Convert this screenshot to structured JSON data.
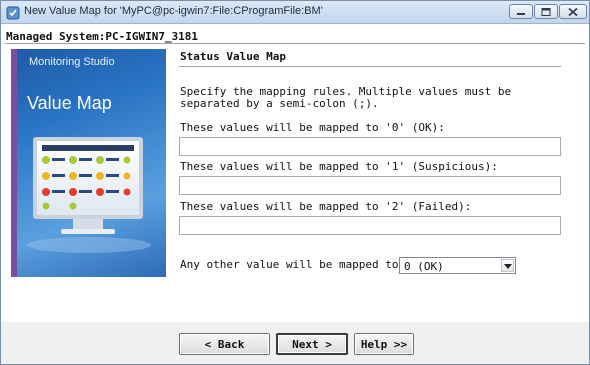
{
  "window": {
    "title": "New Value Map for 'MyPC@pc-igwin7:File:CProgramFile:BM'"
  },
  "system": {
    "label": "Managed System:PC-IGWIN7_3181"
  },
  "banner": {
    "brand": "Monitoring Studio",
    "title": "Value Map"
  },
  "content": {
    "heading": "Status Value Map",
    "instructions": "Specify the mapping rules. Multiple values must be separated by a semi-colon (;).",
    "fields": [
      {
        "label": "These values will be mapped to '0' (OK):",
        "value": ""
      },
      {
        "label": "These values will be mapped to '1' (Suspicious):",
        "value": ""
      },
      {
        "label": "These values will be mapped to '2' (Failed):",
        "value": ""
      }
    ],
    "other_label": "Any other value will be mapped to",
    "other_select": {
      "selected": "0 (OK)"
    }
  },
  "buttons": {
    "back": "< Back",
    "next": "Next >",
    "help": "Help >>"
  }
}
